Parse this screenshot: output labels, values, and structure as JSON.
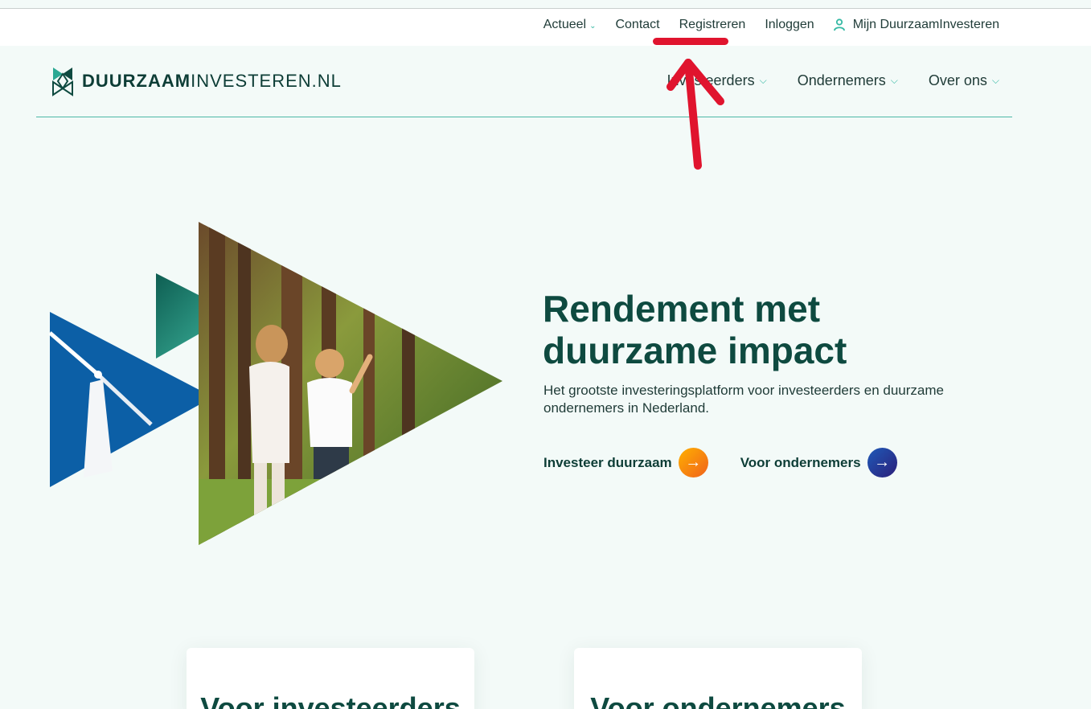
{
  "topbar": {
    "actueel": "Actueel",
    "contact": "Contact",
    "registreren": "Registreren",
    "inloggen": "Inloggen",
    "mijn": "Mijn DuurzaamInvesteren"
  },
  "logo": {
    "bold": "DUURZAAM",
    "rest": "INVESTEREN.NL"
  },
  "mainnav": {
    "investeerders": "Investeerders",
    "ondernemers": "Ondernemers",
    "over_ons": "Over ons"
  },
  "hero": {
    "title_line1": "Rendement met",
    "title_line2": "duurzame impact",
    "subtitle": "Het grootste investeringsplatform voor investeerders en duurzame ondernemers in Nederland.",
    "cta_investeer": "Investeer duurzaam",
    "cta_ondernemers": "Voor ondernemers"
  },
  "cards": {
    "investeerders": "Voor investeerders",
    "ondernemers": "Voor ondernemers"
  },
  "colors": {
    "brand_dark": "#0e4a40",
    "accent_teal": "#35b9a4",
    "annotation_red": "#e0142e",
    "cta_orange": "#f0621c",
    "cta_blue": "#2b1f7a"
  }
}
